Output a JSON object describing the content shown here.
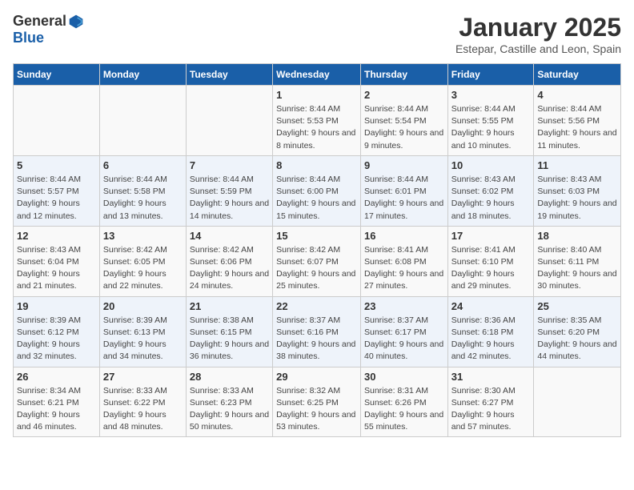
{
  "logo": {
    "general": "General",
    "blue": "Blue"
  },
  "title": "January 2025",
  "location": "Estepar, Castille and Leon, Spain",
  "days_header": [
    "Sunday",
    "Monday",
    "Tuesday",
    "Wednesday",
    "Thursday",
    "Friday",
    "Saturday"
  ],
  "weeks": [
    [
      {
        "day": "",
        "info": ""
      },
      {
        "day": "",
        "info": ""
      },
      {
        "day": "",
        "info": ""
      },
      {
        "day": "1",
        "info": "Sunrise: 8:44 AM\nSunset: 5:53 PM\nDaylight: 9 hours and 8 minutes."
      },
      {
        "day": "2",
        "info": "Sunrise: 8:44 AM\nSunset: 5:54 PM\nDaylight: 9 hours and 9 minutes."
      },
      {
        "day": "3",
        "info": "Sunrise: 8:44 AM\nSunset: 5:55 PM\nDaylight: 9 hours and 10 minutes."
      },
      {
        "day": "4",
        "info": "Sunrise: 8:44 AM\nSunset: 5:56 PM\nDaylight: 9 hours and 11 minutes."
      }
    ],
    [
      {
        "day": "5",
        "info": "Sunrise: 8:44 AM\nSunset: 5:57 PM\nDaylight: 9 hours and 12 minutes."
      },
      {
        "day": "6",
        "info": "Sunrise: 8:44 AM\nSunset: 5:58 PM\nDaylight: 9 hours and 13 minutes."
      },
      {
        "day": "7",
        "info": "Sunrise: 8:44 AM\nSunset: 5:59 PM\nDaylight: 9 hours and 14 minutes."
      },
      {
        "day": "8",
        "info": "Sunrise: 8:44 AM\nSunset: 6:00 PM\nDaylight: 9 hours and 15 minutes."
      },
      {
        "day": "9",
        "info": "Sunrise: 8:44 AM\nSunset: 6:01 PM\nDaylight: 9 hours and 17 minutes."
      },
      {
        "day": "10",
        "info": "Sunrise: 8:43 AM\nSunset: 6:02 PM\nDaylight: 9 hours and 18 minutes."
      },
      {
        "day": "11",
        "info": "Sunrise: 8:43 AM\nSunset: 6:03 PM\nDaylight: 9 hours and 19 minutes."
      }
    ],
    [
      {
        "day": "12",
        "info": "Sunrise: 8:43 AM\nSunset: 6:04 PM\nDaylight: 9 hours and 21 minutes."
      },
      {
        "day": "13",
        "info": "Sunrise: 8:42 AM\nSunset: 6:05 PM\nDaylight: 9 hours and 22 minutes."
      },
      {
        "day": "14",
        "info": "Sunrise: 8:42 AM\nSunset: 6:06 PM\nDaylight: 9 hours and 24 minutes."
      },
      {
        "day": "15",
        "info": "Sunrise: 8:42 AM\nSunset: 6:07 PM\nDaylight: 9 hours and 25 minutes."
      },
      {
        "day": "16",
        "info": "Sunrise: 8:41 AM\nSunset: 6:08 PM\nDaylight: 9 hours and 27 minutes."
      },
      {
        "day": "17",
        "info": "Sunrise: 8:41 AM\nSunset: 6:10 PM\nDaylight: 9 hours and 29 minutes."
      },
      {
        "day": "18",
        "info": "Sunrise: 8:40 AM\nSunset: 6:11 PM\nDaylight: 9 hours and 30 minutes."
      }
    ],
    [
      {
        "day": "19",
        "info": "Sunrise: 8:39 AM\nSunset: 6:12 PM\nDaylight: 9 hours and 32 minutes."
      },
      {
        "day": "20",
        "info": "Sunrise: 8:39 AM\nSunset: 6:13 PM\nDaylight: 9 hours and 34 minutes."
      },
      {
        "day": "21",
        "info": "Sunrise: 8:38 AM\nSunset: 6:15 PM\nDaylight: 9 hours and 36 minutes."
      },
      {
        "day": "22",
        "info": "Sunrise: 8:37 AM\nSunset: 6:16 PM\nDaylight: 9 hours and 38 minutes."
      },
      {
        "day": "23",
        "info": "Sunrise: 8:37 AM\nSunset: 6:17 PM\nDaylight: 9 hours and 40 minutes."
      },
      {
        "day": "24",
        "info": "Sunrise: 8:36 AM\nSunset: 6:18 PM\nDaylight: 9 hours and 42 minutes."
      },
      {
        "day": "25",
        "info": "Sunrise: 8:35 AM\nSunset: 6:20 PM\nDaylight: 9 hours and 44 minutes."
      }
    ],
    [
      {
        "day": "26",
        "info": "Sunrise: 8:34 AM\nSunset: 6:21 PM\nDaylight: 9 hours and 46 minutes."
      },
      {
        "day": "27",
        "info": "Sunrise: 8:33 AM\nSunset: 6:22 PM\nDaylight: 9 hours and 48 minutes."
      },
      {
        "day": "28",
        "info": "Sunrise: 8:33 AM\nSunset: 6:23 PM\nDaylight: 9 hours and 50 minutes."
      },
      {
        "day": "29",
        "info": "Sunrise: 8:32 AM\nSunset: 6:25 PM\nDaylight: 9 hours and 53 minutes."
      },
      {
        "day": "30",
        "info": "Sunrise: 8:31 AM\nSunset: 6:26 PM\nDaylight: 9 hours and 55 minutes."
      },
      {
        "day": "31",
        "info": "Sunrise: 8:30 AM\nSunset: 6:27 PM\nDaylight: 9 hours and 57 minutes."
      },
      {
        "day": "",
        "info": ""
      }
    ]
  ]
}
